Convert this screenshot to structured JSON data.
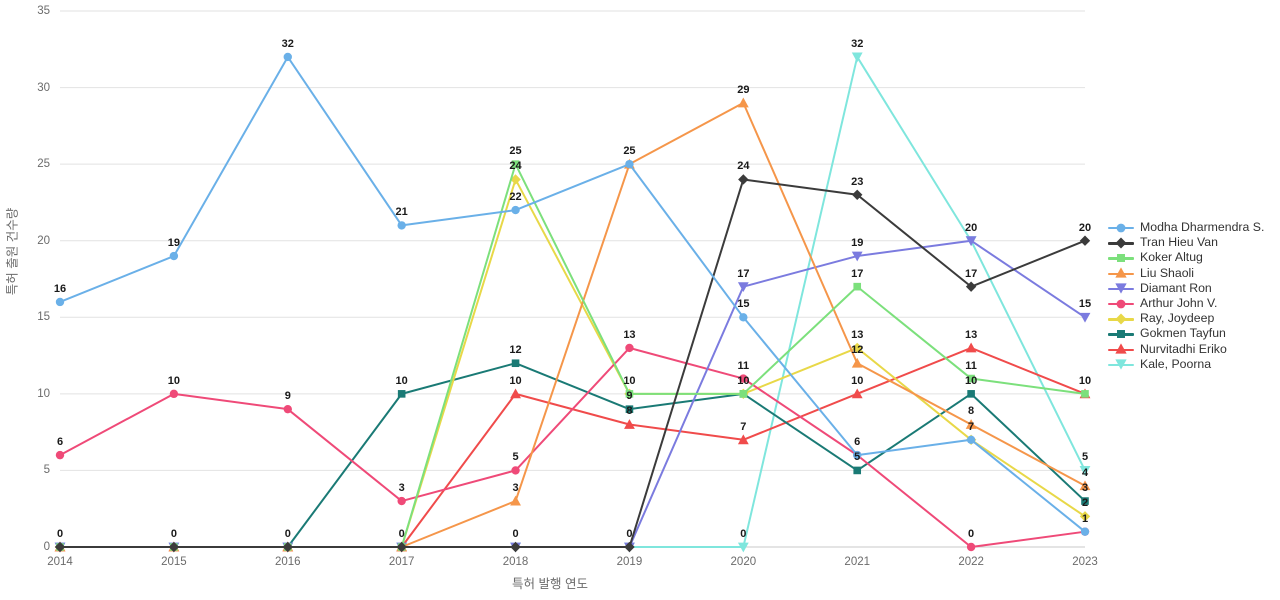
{
  "chart_data": {
    "type": "line",
    "title": "",
    "xlabel": "특허 발행 연도",
    "ylabel": "특허 출원 건수량",
    "categories": [
      "2014",
      "2015",
      "2016",
      "2017",
      "2018",
      "2019",
      "2020",
      "2021",
      "2022",
      "2023"
    ],
    "ylim": [
      0,
      35
    ],
    "yticks": [
      0,
      5,
      10,
      15,
      20,
      25,
      30,
      35
    ],
    "grid": true,
    "legend_position": "right",
    "show_point_labels": true,
    "series": [
      {
        "name": "Modha Dharmendra S.",
        "color": "#6ab0e8",
        "marker": "circle",
        "values": [
          16,
          19,
          32,
          21,
          22,
          25,
          15,
          6,
          7,
          1
        ]
      },
      {
        "name": "Tran Hieu Van",
        "color": "#3b3b3b",
        "marker": "diamond",
        "values": [
          0,
          0,
          0,
          0,
          0,
          0,
          24,
          23,
          17,
          20
        ]
      },
      {
        "name": "Koker Altug",
        "color": "#7ce07c",
        "marker": "square",
        "values": [
          0,
          0,
          0,
          0,
          25,
          10,
          10,
          17,
          11,
          10
        ]
      },
      {
        "name": "Liu Shaoli",
        "color": "#f5964a",
        "marker": "triangle-up",
        "values": [
          0,
          0,
          0,
          0,
          3,
          25,
          29,
          12,
          8,
          4
        ]
      },
      {
        "name": "Diamant Ron",
        "color": "#7b7bdf",
        "marker": "triangle-down",
        "values": [
          0,
          0,
          0,
          0,
          0,
          0,
          17,
          19,
          20,
          15
        ]
      },
      {
        "name": "Arthur John V.",
        "color": "#ef4a78",
        "marker": "circle",
        "values": [
          6,
          10,
          9,
          3,
          5,
          13,
          11,
          6,
          0,
          1
        ]
      },
      {
        "name": "Ray, Joydeep",
        "color": "#e8d848",
        "marker": "diamond",
        "values": [
          0,
          0,
          0,
          0,
          24,
          10,
          10,
          13,
          7,
          2
        ]
      },
      {
        "name": "Gokmen Tayfun",
        "color": "#1a7a75",
        "marker": "square",
        "values": [
          0,
          0,
          0,
          10,
          12,
          9,
          10,
          5,
          10,
          3
        ]
      },
      {
        "name": "Nurvitadhi Eriko",
        "color": "#f04b4b",
        "marker": "triangle-up",
        "values": [
          0,
          0,
          0,
          0,
          10,
          8,
          7,
          10,
          13,
          10
        ]
      },
      {
        "name": "Kale, Poorna",
        "color": "#7fe6dd",
        "marker": "triangle-down",
        "values": [
          0,
          0,
          0,
          0,
          0,
          0,
          0,
          32,
          20,
          5
        ]
      }
    ]
  },
  "legend": {
    "items": [
      "Modha Dharmendra S.",
      "Tran Hieu Van",
      "Koker Altug",
      "Liu Shaoli",
      "Diamant Ron",
      "Arthur John V.",
      "Ray, Joydeep",
      "Gokmen Tayfun",
      "Nurvitadhi Eriko",
      "Kale, Poorna"
    ]
  }
}
